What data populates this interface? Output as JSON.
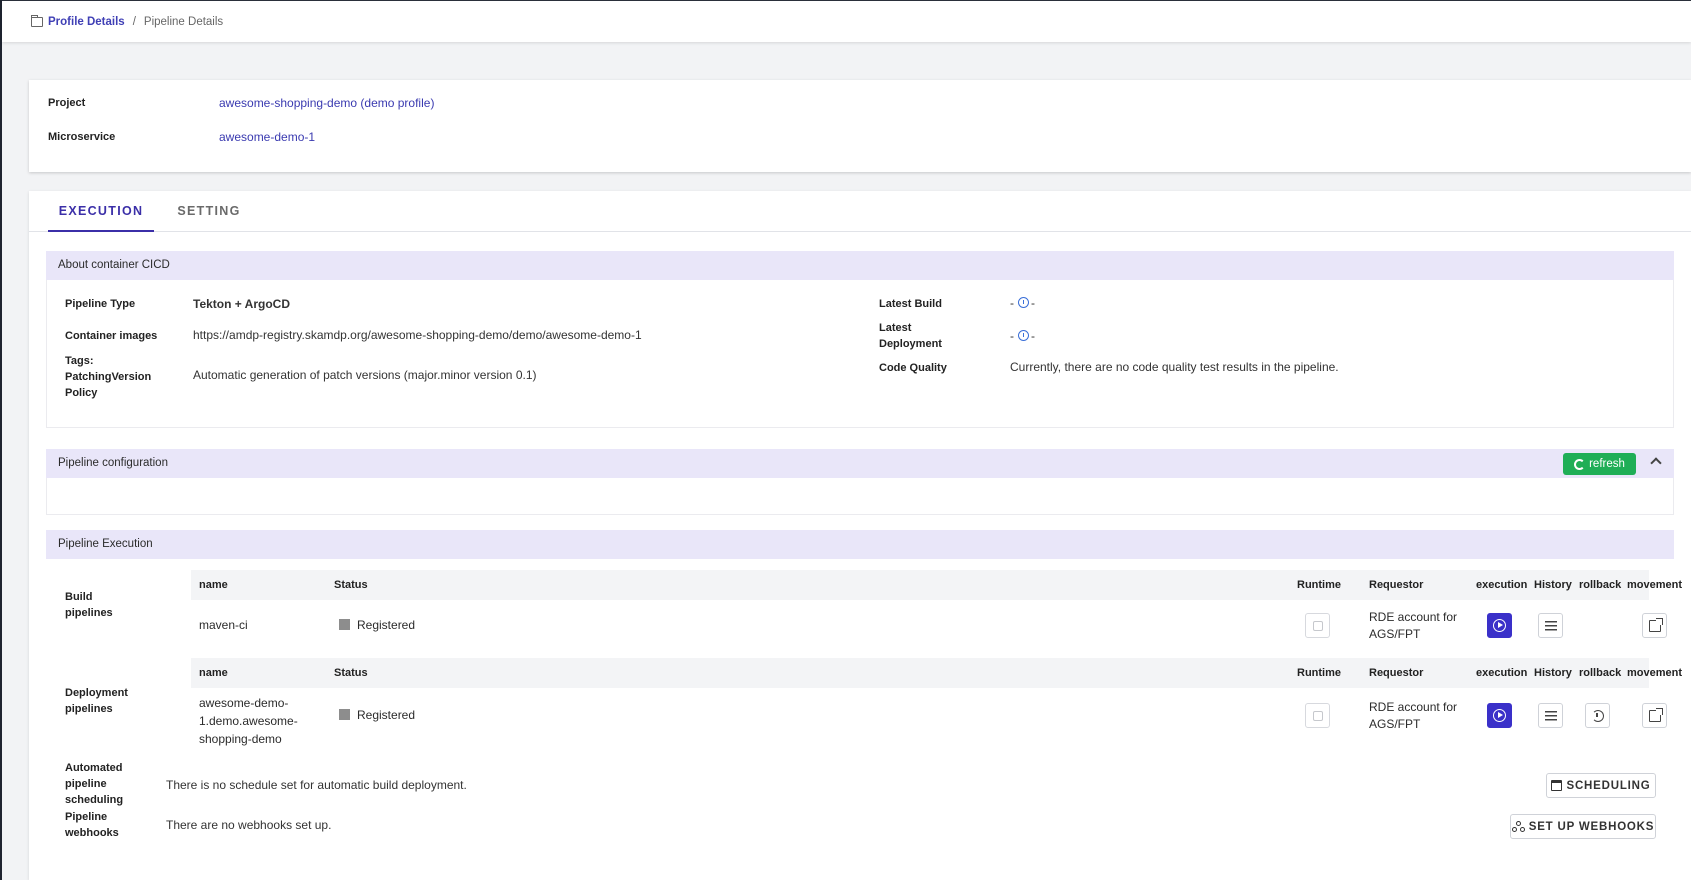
{
  "breadcrumb": {
    "root": "Profile Details",
    "sep": "/",
    "current": "Pipeline Details"
  },
  "project": {
    "project_label": "Project",
    "project_value": "awesome-shopping-demo (demo profile)",
    "microservice_label": "Microservice",
    "microservice_value": "awesome-demo-1"
  },
  "tabs": {
    "execution": "EXECUTION",
    "setting": "SETTING"
  },
  "about": {
    "title": "About container CICD",
    "pipeline_type_label": "Pipeline Type",
    "pipeline_type_value": "Tekton + ArgoCD",
    "container_images_label": "Container images",
    "container_images_value": "https://amdp-registry.skamdp.org/awesome-shopping-demo/demo/awesome-demo-1",
    "tags_label": "Tags:",
    "patching_label": "PatchingVersion Policy",
    "patching_value": "Automatic generation of patch versions (major.minor version 0.1)",
    "latest_build_label": "Latest Build",
    "latest_build_pre": "-",
    "latest_build_post": "-",
    "latest_deploy_label": "Latest Deployment",
    "latest_deploy_pre": "-",
    "latest_deploy_post": "-",
    "code_quality_label": "Code Quality",
    "code_quality_value": "Currently, there are no code quality test results in the pipeline."
  },
  "config": {
    "title": "Pipeline configuration",
    "refresh_label": "refresh"
  },
  "execution": {
    "title": "Pipeline Execution",
    "columns": {
      "name": "name",
      "status": "Status",
      "runtime": "Runtime",
      "requestor": "Requestor",
      "execution": "execution",
      "history": "History",
      "rollback": "rollback",
      "movement": "movement"
    },
    "build": {
      "label": "Build pipelines",
      "name": "maven-ci",
      "status": "Registered",
      "requestor": "RDE account for AGS/FPT"
    },
    "deploy": {
      "label": "Deployment pipelines",
      "name": "awesome-demo-1.demo.awesome-shopping-demo",
      "status": "Registered",
      "requestor": "RDE account for AGS/FPT"
    },
    "scheduling": {
      "label": "Automated pipeline scheduling",
      "text": "There is no schedule set for automatic build deployment.",
      "button": "SCHEDULING"
    },
    "webhooks": {
      "label": "Pipeline webhooks",
      "text": "There are no webhooks set up.",
      "button": "SET UP WEBHOOKS"
    }
  },
  "colors": {
    "accent": "#3b2fa8",
    "section_bg": "#e9e6f9",
    "refresh_green": "#1fae56",
    "play_blue": "#3a30c9"
  }
}
